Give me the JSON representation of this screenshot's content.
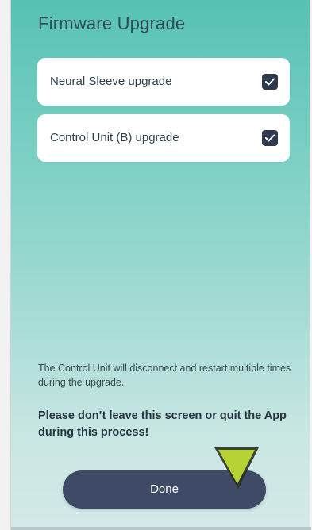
{
  "screen": {
    "title": "Firmware Upgrade"
  },
  "options": [
    {
      "label": "Neural Sleeve upgrade",
      "checked": true
    },
    {
      "label": "Control Unit (B) upgrade",
      "checked": true
    }
  ],
  "notice": {
    "info": "The Control Unit will disconnect and restart multiple times during the upgrade.",
    "warning": "Please don’t leave this screen or quit the App during this process!"
  },
  "actions": {
    "done_label": "Done"
  },
  "icons": {
    "checkbox": "checkmark-icon",
    "cursor": "arrow-cursor-icon"
  },
  "colors": {
    "gradient_top": "#56c2b4",
    "gradient_bottom": "#d4eae8",
    "button": "#3f4b66",
    "checkbox": "#2f3a4f",
    "cursor": "#b5d334"
  }
}
